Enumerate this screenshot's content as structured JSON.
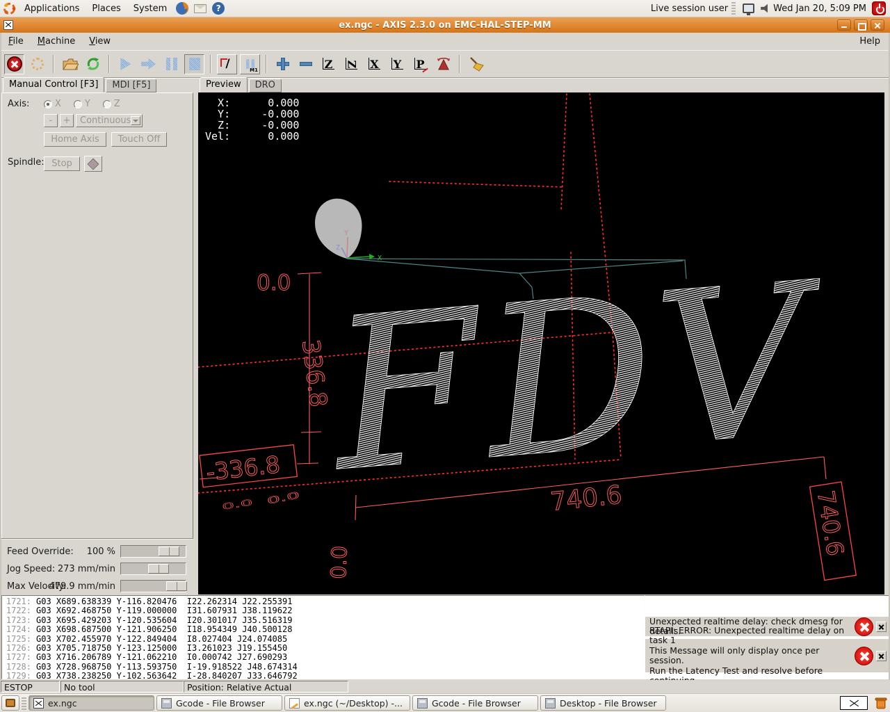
{
  "panel": {
    "menus": [
      {
        "label": "Applications"
      },
      {
        "label": "Places"
      },
      {
        "label": "System"
      }
    ],
    "help_glyph": "?",
    "user": "Live session user",
    "clock": "Wed Jan 20,  5:09 PM"
  },
  "titlebar": {
    "title": "ex.ngc - AXIS 2.3.0 on EMC-HAL-STEP-MM"
  },
  "menubar": {
    "items": [
      {
        "key": "F",
        "rest": "ile"
      },
      {
        "key": "M",
        "rest": "achine"
      },
      {
        "key": "V",
        "rest": "iew"
      }
    ],
    "help": "Help"
  },
  "toolbar": {
    "m1": "M1",
    "slash": "/",
    "views": [
      "Z",
      "Z",
      "X",
      "Y",
      "P"
    ]
  },
  "left_tabs": [
    {
      "label": "Manual Control [F3]"
    },
    {
      "label": "MDI [F5]"
    }
  ],
  "manual": {
    "axis_label": "Axis:",
    "axes": [
      "X",
      "Y",
      "Z"
    ],
    "minus": "-",
    "plus": "+",
    "jog_mode": "Continuous",
    "home": "Home Axis",
    "touch": "Touch Off",
    "spindle_label": "Spindle:",
    "stop": "Stop"
  },
  "sliders": [
    {
      "label": "Feed Override:",
      "value": "100 %",
      "pos": 54
    },
    {
      "label": "Jog Speed:",
      "value": "273 mm/min",
      "pos": 39
    },
    {
      "label": "Max Velocity:",
      "value": "479.9 mm/min",
      "pos": 65
    }
  ],
  "preview": {
    "tabs": [
      {
        "label": "Preview"
      },
      {
        "label": "DRO"
      }
    ],
    "dro": [
      "  X:      0.000",
      "  Y:     -0.000",
      "  Z:     -0.000",
      "Vel:      0.000"
    ],
    "letters": "FDV",
    "dims": {
      "top_zero": "0.0",
      "height": "336.8",
      "height_box": "-336.8",
      "width": "740.6",
      "width_box": "740.6",
      "origin_zero": "0.0",
      "flat_a": "0.0",
      "flat_b": "0.0"
    },
    "axes": {
      "x": "X",
      "y": "Y",
      "z": "Z"
    }
  },
  "gcode": {
    "lines": [
      {
        "num": "1721:",
        "code": "G03 X689.638339 Y-116.820476  I22.262314 J22.255391"
      },
      {
        "num": "1722:",
        "code": "G03 X692.468750 Y-119.000000  I31.607931 J38.119622"
      },
      {
        "num": "1723:",
        "code": "G03 X695.429203 Y-120.535604  I20.301017 J35.516319"
      },
      {
        "num": "1724:",
        "code": "G03 X698.687500 Y-121.906250  I18.954349 J40.500128"
      },
      {
        "num": "1725:",
        "code": "G03 X702.455970 Y-122.849404  I8.027404 J24.074085"
      },
      {
        "num": "1726:",
        "code": "G03 X705.718750 Y-123.125000  I3.261023 J19.155450"
      },
      {
        "num": "1727:",
        "code": "G03 X716.206789 Y-121.062210  I0.000742 J27.690293"
      },
      {
        "num": "1728:",
        "code": "G03 X728.968750 Y-113.593750  I-19.918522 J48.674314"
      },
      {
        "num": "1729:",
        "code": "G03 X738.238250 Y-102.563642  I-28.840207 J33.646792"
      }
    ]
  },
  "errors": {
    "first": {
      "line1": "Unexpected realtime delay: check dmesg for details."
    },
    "second": {
      "line1": "RTAPI: ERROR: Unexpected realtime delay on task 1",
      "line2": "This Message will only display once per session.",
      "line3": "Run the Latency Test and resolve before continuing."
    }
  },
  "statusbar": {
    "estop": "ESTOP",
    "tool": "No tool",
    "position": "Position: Relative Actual"
  },
  "taskbar": {
    "items": [
      {
        "label": "ex.ngc"
      },
      {
        "label": "Gcode - File Browser"
      },
      {
        "label": "ex.ngc (~/Desktop) -..."
      },
      {
        "label": "Gcode - File Browser"
      },
      {
        "label": "Desktop - File Browser"
      }
    ]
  }
}
